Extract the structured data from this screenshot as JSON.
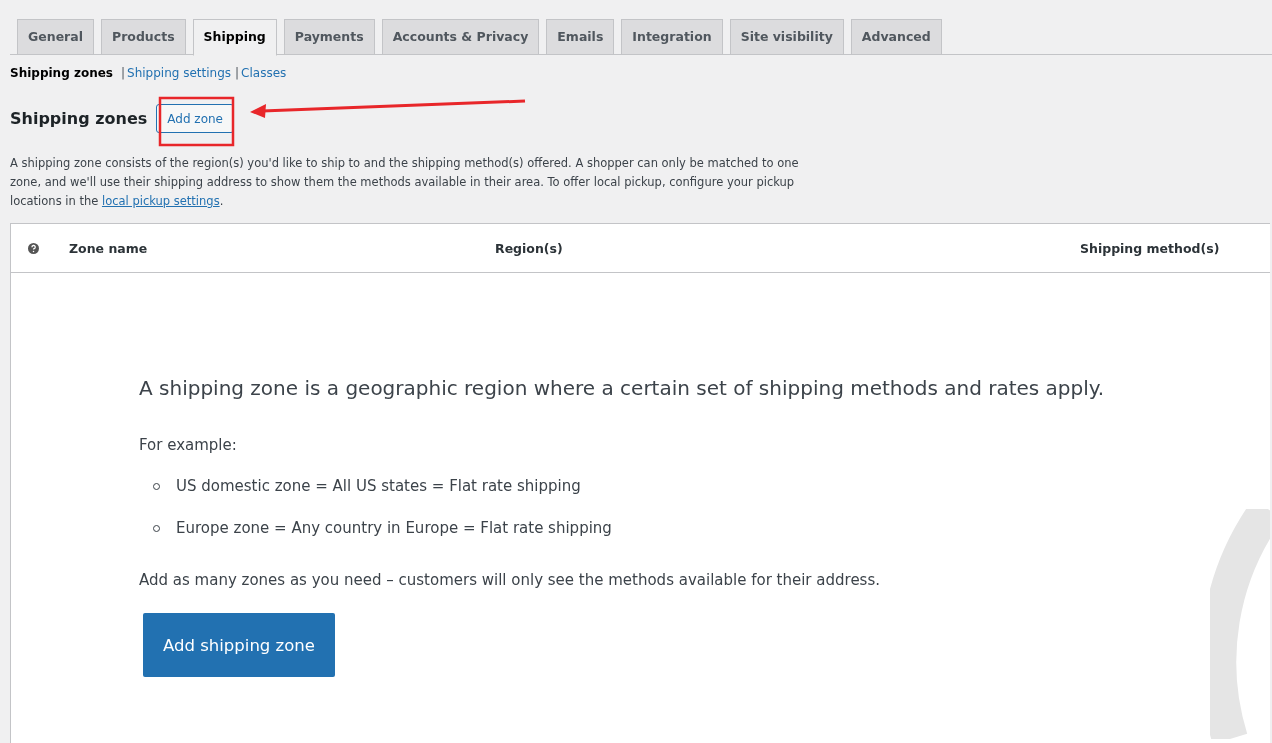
{
  "tabs": [
    {
      "label": "General",
      "selected": false
    },
    {
      "label": "Products",
      "selected": false
    },
    {
      "label": "Shipping",
      "selected": true
    },
    {
      "label": "Payments",
      "selected": false
    },
    {
      "label": "Accounts & Privacy",
      "selected": false
    },
    {
      "label": "Emails",
      "selected": false
    },
    {
      "label": "Integration",
      "selected": false
    },
    {
      "label": "Site visibility",
      "selected": false
    },
    {
      "label": "Advanced",
      "selected": false
    }
  ],
  "subnav": [
    {
      "label": "Shipping zones",
      "selected": true
    },
    {
      "separator": "|",
      "label": "Shipping settings",
      "selected": false
    },
    {
      "separator": "|",
      "label": "Classes",
      "selected": false
    }
  ],
  "heading": {
    "title": "Shipping zones",
    "button": "Add zone"
  },
  "description": {
    "text": "A shipping zone consists of the region(s) you'd like to ship to and the shipping method(s) offered. A shopper can only be matched to one zone, and we'll use their shipping address to show them the methods available in their area. To offer local pickup, configure your pickup locations in the ",
    "link": "local pickup settings",
    "after": "."
  },
  "table": {
    "columns": [
      "Zone name",
      "Region(s)",
      "Shipping method(s)"
    ]
  },
  "empty_state": {
    "title": "A shipping zone is a geographic region where a certain set of shipping methods and rates apply.",
    "intro": "For example:",
    "examples": [
      "US domestic zone = All US states = Flat rate shipping",
      "Europe zone = Any country in Europe = Flat rate shipping"
    ],
    "note": "Add as many zones as you need – customers will only see the methods available for their address.",
    "button": "Add shipping zone"
  }
}
